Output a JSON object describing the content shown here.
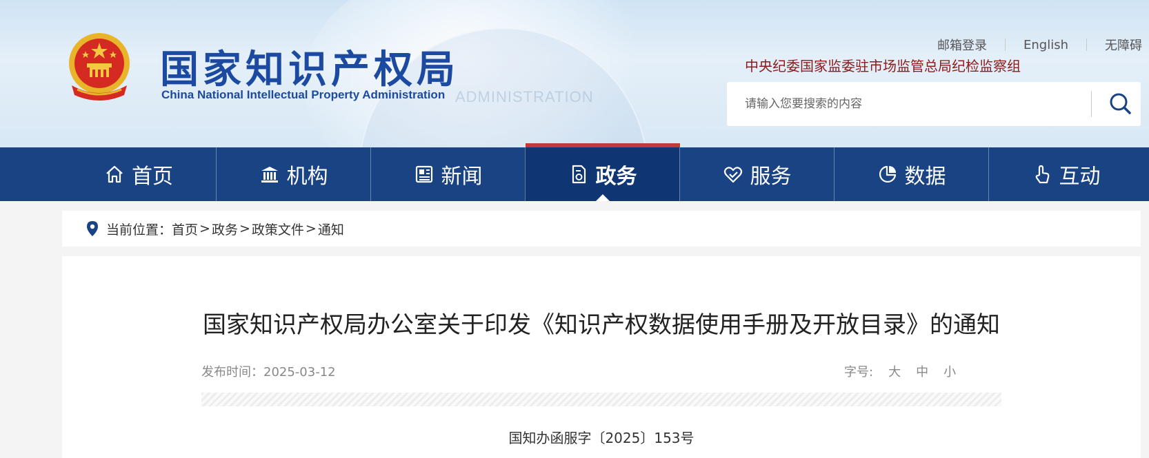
{
  "header": {
    "logo_cn": "国家知识产权局",
    "logo_en": "China National Intellectual Property Administration",
    "ghost_text": "ADMINISTRATION",
    "links": [
      "邮箱登录",
      "English",
      "无障碍"
    ],
    "jiwei": "中央纪委国家监委驻市场监管总局纪检监察组",
    "search_placeholder": "请输入您要搜索的内容"
  },
  "nav": {
    "items": [
      {
        "label": "首页",
        "icon": "home-icon"
      },
      {
        "label": "机构",
        "icon": "institution-icon"
      },
      {
        "label": "新闻",
        "icon": "news-icon"
      },
      {
        "label": "政务",
        "icon": "government-affairs-icon",
        "active": true
      },
      {
        "label": "服务",
        "icon": "service-icon"
      },
      {
        "label": "数据",
        "icon": "pie-chart-icon"
      },
      {
        "label": "互动",
        "icon": "interaction-icon"
      }
    ]
  },
  "breadcrumb": {
    "prefix": "当前位置：",
    "items": [
      "首页",
      "政务",
      "政策文件",
      "通知"
    ],
    "separator": ">"
  },
  "article": {
    "title": "国家知识产权局办公室关于印发《知识产权数据使用手册及开放目录》的通知",
    "date_label": "发布时间：",
    "date": "2025-03-12",
    "fontsize_label": "字号:",
    "fontsize_options": [
      "大",
      "中",
      "小"
    ],
    "doc_number": "国知办函服字〔2025〕153号"
  },
  "colors": {
    "nav_bg": "#1a4383",
    "nav_active_bg": "#0f3572",
    "nav_active_top": "#c0393b",
    "logo_blue": "#1c4aa0",
    "jiwei_red": "#8b1a1a"
  }
}
